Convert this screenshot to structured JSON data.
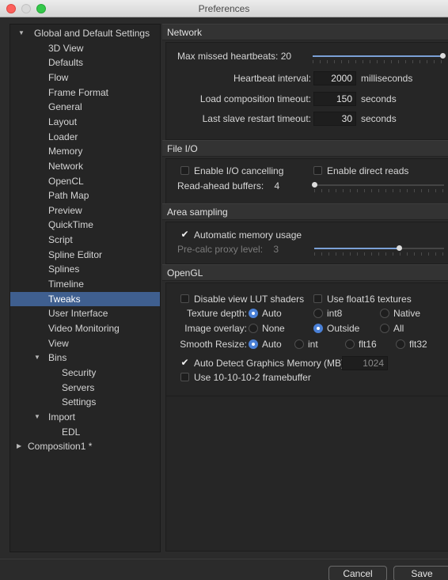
{
  "window": {
    "title": "Preferences"
  },
  "sidebar": {
    "items": [
      {
        "label": "Global and Default Settings",
        "arrow": "▼"
      },
      {
        "label": "3D View"
      },
      {
        "label": "Defaults"
      },
      {
        "label": "Flow"
      },
      {
        "label": "Frame Format"
      },
      {
        "label": "General"
      },
      {
        "label": "Layout"
      },
      {
        "label": "Loader"
      },
      {
        "label": "Memory"
      },
      {
        "label": "Network"
      },
      {
        "label": "OpenCL"
      },
      {
        "label": "Path Map"
      },
      {
        "label": "Preview"
      },
      {
        "label": "QuickTime"
      },
      {
        "label": "Script"
      },
      {
        "label": "Spline Editor"
      },
      {
        "label": "Splines"
      },
      {
        "label": "Timeline"
      },
      {
        "label": "Tweaks"
      },
      {
        "label": "User Interface"
      },
      {
        "label": "Video Monitoring"
      },
      {
        "label": "View"
      },
      {
        "label": "Bins",
        "arrow": "▼"
      },
      {
        "label": "Security"
      },
      {
        "label": "Servers"
      },
      {
        "label": "Settings"
      },
      {
        "label": "Import",
        "arrow": "▼"
      },
      {
        "label": "EDL"
      },
      {
        "label": "Composition1 *",
        "arrow": "▶"
      }
    ],
    "selected": "Tweaks"
  },
  "network": {
    "header": "Network",
    "max_missed_label": "Max missed heartbeats:",
    "max_missed_value": "20",
    "max_missed_level": 1.0,
    "heartbeat_label": "Heartbeat interval:",
    "heartbeat_value": "2000",
    "heartbeat_unit": "milliseconds",
    "load_label": "Load composition timeout:",
    "load_value": "150",
    "load_unit": "seconds",
    "restart_label": "Last slave restart timeout:",
    "restart_value": "30",
    "restart_unit": "seconds"
  },
  "fileio": {
    "header": "File I/O",
    "enable_io_cancel": "Enable I/O cancelling",
    "enable_direct": "Enable direct reads",
    "readahead_label": "Read-ahead buffers:",
    "readahead_value": "4",
    "readahead_level": 0.0
  },
  "area": {
    "header": "Area sampling",
    "auto_mem": "Automatic memory usage",
    "auto_mem_checked": true,
    "precalc_label": "Pre-calc proxy level:",
    "precalc_value": "3",
    "precalc_level": 0.65
  },
  "opengl": {
    "header": "OpenGL",
    "disable_lut": "Disable view LUT shaders",
    "use_float16": "Use float16 textures",
    "texture_depth_label": "Texture depth:",
    "texture_options": [
      "Auto",
      "int8",
      "Native"
    ],
    "texture_selected": "Auto",
    "overlay_label": "Image overlay:",
    "overlay_options": [
      "None",
      "Outside",
      "All"
    ],
    "overlay_selected": "Outside",
    "smooth_label": "Smooth Resize:",
    "smooth_options": [
      "Auto",
      "int",
      "flt16",
      "flt32"
    ],
    "smooth_selected": "Auto",
    "auto_detect": "Auto Detect Graphics Memory (MB)",
    "auto_detect_checked": true,
    "auto_detect_value": "1024",
    "use_10bit": "Use 10-10-10-2 framebuffer"
  },
  "buttons": {
    "cancel": "Cancel",
    "save": "Save"
  },
  "colors": {
    "selection": "#3f5f8f",
    "slider_fill": "#7ba0d6",
    "radio_on": "#4a80d6"
  }
}
